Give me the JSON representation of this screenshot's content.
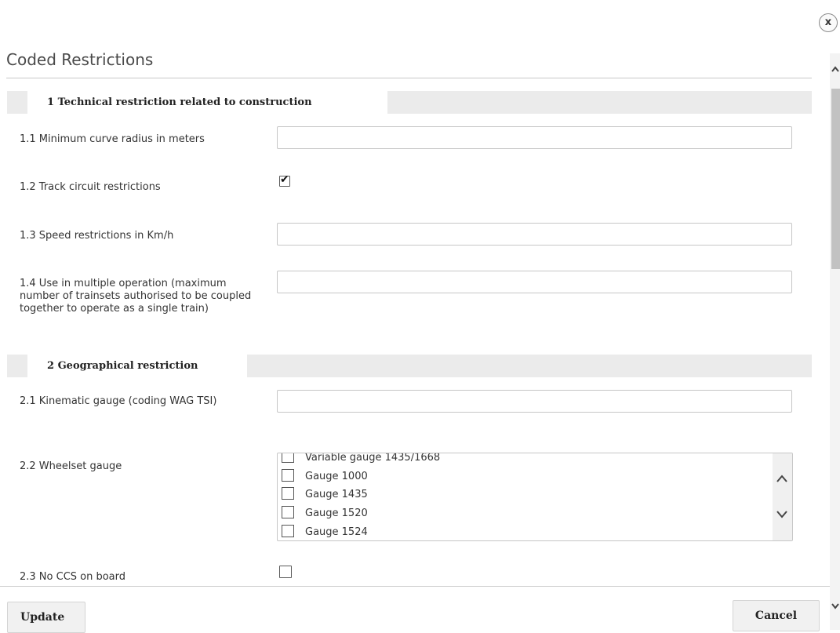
{
  "dialog": {
    "title": "Coded Restrictions",
    "close_icon": "close-icon",
    "close_glyph": "x"
  },
  "sections": [
    {
      "label": "1 Technical restriction related to construction"
    },
    {
      "label": "2 Geographical restriction"
    }
  ],
  "fields": {
    "min_curve_radius": {
      "label": "1.1 Minimum curve radius in meters",
      "value": "",
      "placeholder": ""
    },
    "track_circuit": {
      "label": "1.2 Track circuit restrictions",
      "checked": true
    },
    "speed_restrictions": {
      "label": "1.3 Speed restrictions in Km/h",
      "value": "",
      "placeholder": ""
    },
    "multiple_operation": {
      "label": "1.4 Use in multiple operation (maximum number of trainsets authorised to be coupled together to operate as a single train)",
      "value": "",
      "placeholder": ""
    },
    "kinematic_gauge": {
      "label": "2.1 Kinematic gauge (coding WAG TSI)",
      "value": "",
      "placeholder": ""
    },
    "wheelset_gauge": {
      "label": "2.2 Wheelset gauge",
      "options": [
        {
          "label": "Variable gauge 1435/1668",
          "checked": false
        },
        {
          "label": "Gauge 1000",
          "checked": false
        },
        {
          "label": "Gauge 1435",
          "checked": false
        },
        {
          "label": "Gauge 1520",
          "checked": false
        },
        {
          "label": "Gauge 1524",
          "checked": false
        }
      ]
    },
    "no_ccs": {
      "label": "2.3 No CCS on board",
      "checked": false
    }
  },
  "footer": {
    "update_label": "Update",
    "cancel_label": "Cancel"
  }
}
